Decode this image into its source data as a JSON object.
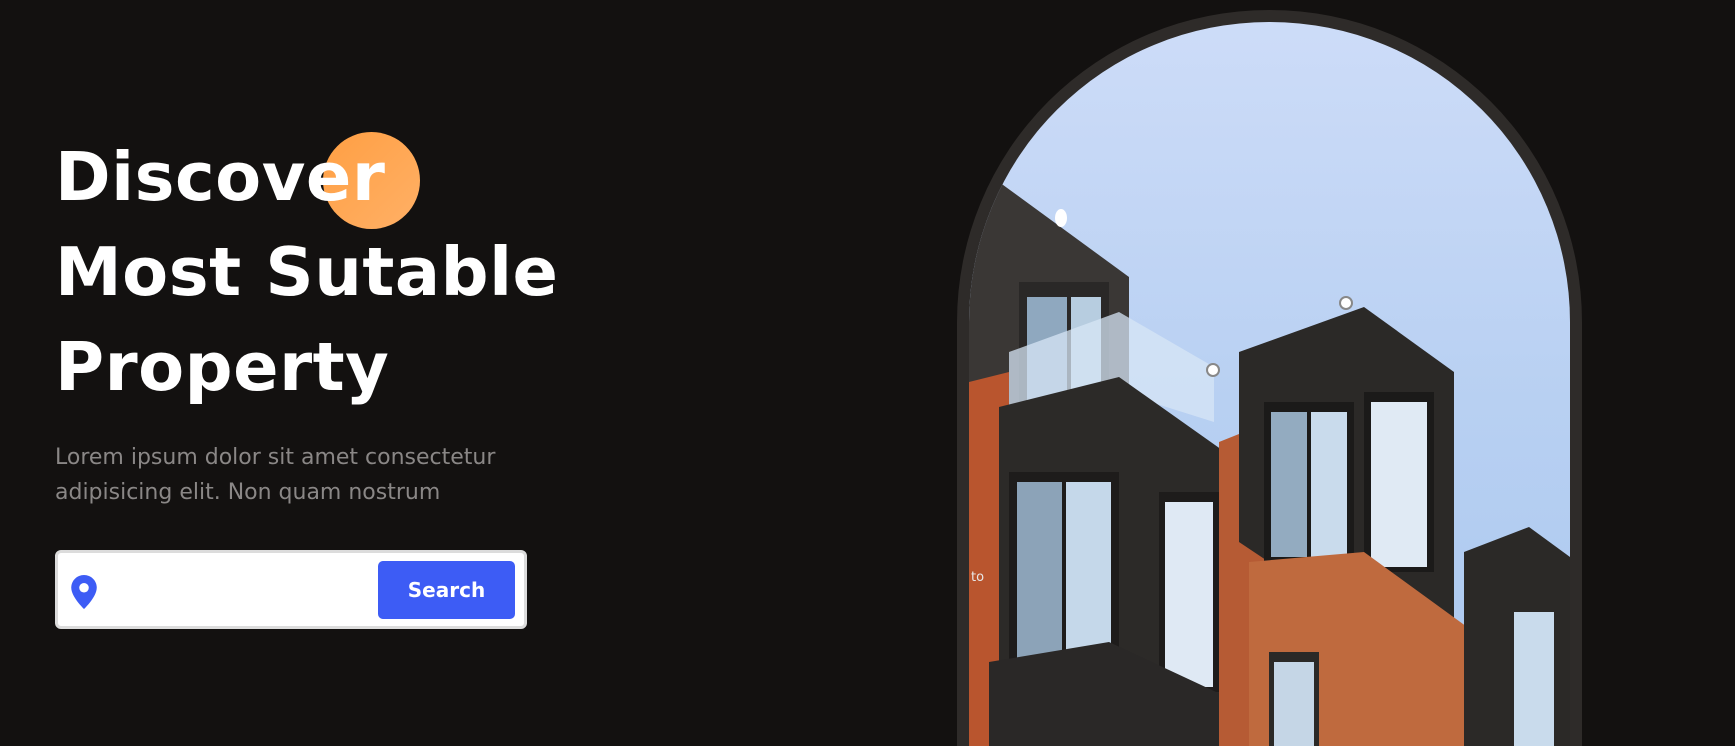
{
  "hero": {
    "title_lines": [
      "Discover",
      "Most Sutable",
      "Property"
    ],
    "subtitle": "Lorem ipsum dolor sit amet consectetur adipisicing elit. Non quam nostrum"
  },
  "search": {
    "value": "",
    "placeholder": "",
    "button_label": "Search",
    "icon": "location-pin-icon"
  },
  "image": {
    "description_icon": "building-photo",
    "caption_fragment": "to"
  },
  "colors": {
    "background": "#131110",
    "accent_orange": "#ff9f43",
    "button_blue": "#3d5cf5",
    "subtitle_gray": "#8a8786",
    "arch_frame": "#2e2b29"
  }
}
